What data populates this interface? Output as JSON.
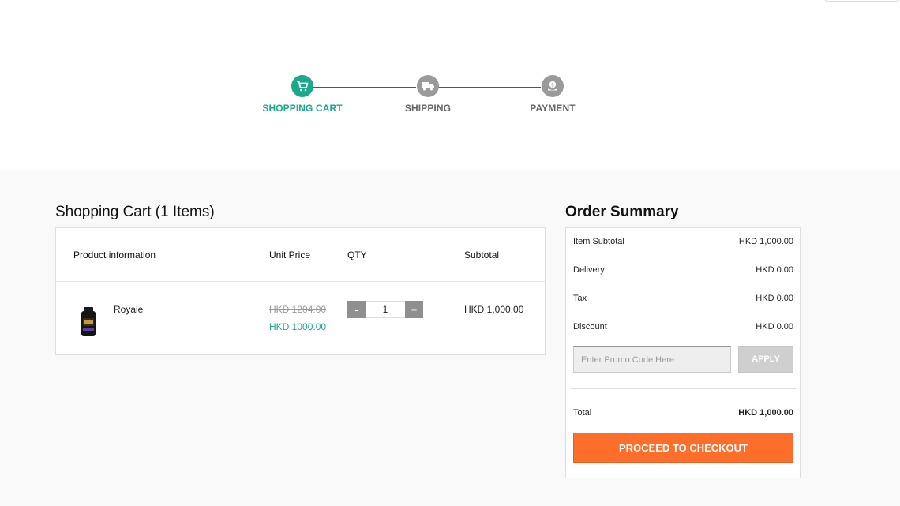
{
  "steps": [
    {
      "label": "SHOPPING CART",
      "icon": "cart-icon",
      "active": true
    },
    {
      "label": "SHIPPING",
      "icon": "truck-icon",
      "active": false
    },
    {
      "label": "PAYMENT",
      "icon": "coin-hand-icon",
      "active": false
    }
  ],
  "cart": {
    "title": "Shopping Cart (1 Items)",
    "columns": [
      "Product information",
      "Unit Price",
      "QTY",
      "Subtotal"
    ],
    "items": [
      {
        "name": "Royale",
        "original_price": "HKD 1204.00",
        "price": "HKD 1000.00",
        "qty": "1",
        "minus_label": "-",
        "plus_label": "+",
        "subtotal": "HKD 1,000.00"
      }
    ]
  },
  "summary": {
    "title": "Order Summary",
    "lines": [
      {
        "label": "Item Subtotal",
        "value": "HKD 1,000.00"
      },
      {
        "label": "Delivery",
        "value": "HKD 0.00"
      },
      {
        "label": "Tax",
        "value": "HKD 0.00"
      },
      {
        "label": "Discount",
        "value": "HKD 0.00"
      }
    ],
    "promo_placeholder": "Enter Promo Code Here",
    "apply_label": "APPLY",
    "total_label": "Total",
    "total_value": "HKD 1,000.00",
    "checkout_label": "PROCEED TO CHECKOUT"
  },
  "colors": {
    "accent": "#1aa98b",
    "checkout": "#fd6e2b",
    "inactive_step": "#9a9a9a"
  }
}
